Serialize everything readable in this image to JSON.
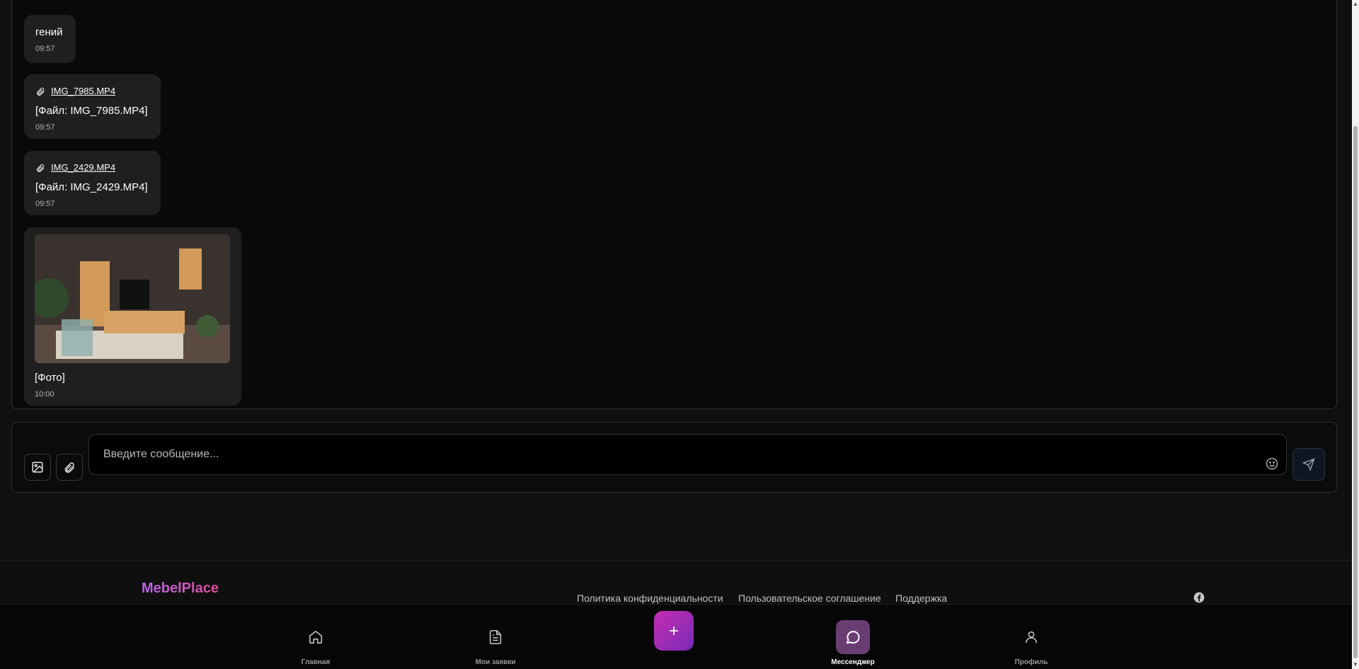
{
  "messages": [
    {
      "text": "гений",
      "time": "09:57"
    },
    {
      "file_name": "IMG_7985.MP4",
      "text": "[Файл: IMG_7985.MP4]",
      "time": "09:57"
    },
    {
      "file_name": "IMG_2429.MP4",
      "text": "[Файл: IMG_2429.MP4]",
      "time": "09:57"
    },
    {
      "text": "[Фото]",
      "time": "10:00"
    }
  ],
  "composer": {
    "placeholder": "Введите сообщение..."
  },
  "footer": {
    "brand": "MebelPlace",
    "links": [
      "Политика конфиденциальности",
      "Пользовательское соглашение",
      "Поддержка"
    ]
  },
  "nav": {
    "items": [
      {
        "label": "Главная",
        "icon": "home-icon"
      },
      {
        "label": "Мои заявки",
        "icon": "document-icon"
      },
      {
        "label": "Мессенджер",
        "icon": "chat-icon",
        "active": true
      },
      {
        "label": "Профиль",
        "icon": "user-icon"
      }
    ],
    "create_icon": "plus-icon"
  },
  "colors": {
    "accent": "#c42cb0",
    "active_nav": "#6a3d72",
    "bubble": "#1f1f1f"
  }
}
